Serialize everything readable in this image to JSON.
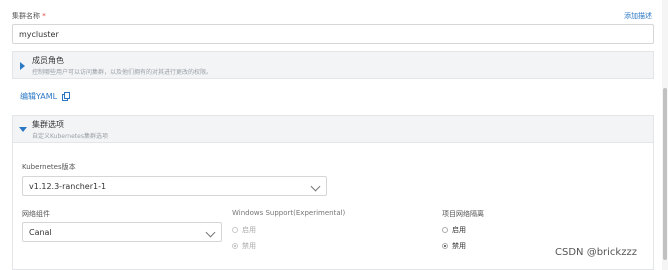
{
  "cluster": {
    "name_label": "集群名称",
    "required_mark": "*",
    "add_description": "添加描述",
    "name_value": "mycluster"
  },
  "member_section": {
    "title": "成员角色",
    "description": "控制哪些用户可以访问集群，以及他们拥有的对其进行更改的权限。"
  },
  "edit_yaml": "编辑YAML",
  "cluster_options": {
    "title": "集群选项",
    "description": "自定义Kubernetes集群选项"
  },
  "k8s_version": {
    "label": "Kubernetes版本",
    "value": "v1.12.3-rancher1-1"
  },
  "network": {
    "label": "网络组件",
    "value": "Canal"
  },
  "windows_support": {
    "label": "Windows Support(Experimental)",
    "options": [
      "启用",
      "禁用"
    ],
    "selected": "禁用"
  },
  "project_isolation": {
    "label": "项目网络隔离",
    "options": [
      "启用",
      "禁用"
    ],
    "selected": "禁用"
  },
  "watermark": "CSDN @brickzzz",
  "colors": {
    "link": "#2b78c5",
    "accent_triangle": "#2b78c5",
    "section_bg": "#f3f4f6"
  }
}
